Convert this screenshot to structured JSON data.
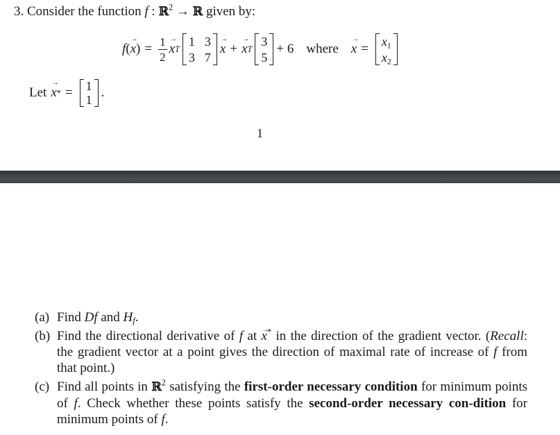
{
  "viewer": {
    "page_gap_color": "#3e4144"
  },
  "page1": {
    "heading": {
      "number": "3.",
      "text_before": "Consider the function",
      "func": "f",
      "colon": " : ",
      "domain": "ℝ",
      "domain_exp": "2",
      "arrow": " → ",
      "codomain": "ℝ",
      "text_after": " given by:"
    },
    "equation": {
      "lhs_func": "f",
      "lhs_arg": "x",
      "equals": "=",
      "frac_num": "1",
      "frac_den": "2",
      "transpose": "T",
      "matrix_A": [
        [
          "1",
          "3"
        ],
        [
          "3",
          "7"
        ]
      ],
      "plus": "+",
      "vector_b": [
        "3",
        "5"
      ],
      "constant": "+ 6",
      "where": "where",
      "x_vec": "x",
      "x_components": [
        "x",
        "x"
      ],
      "x_subscripts": [
        "1",
        "2"
      ]
    },
    "let_line": {
      "text": "Let",
      "var": "x",
      "star": "*",
      "equals": "=",
      "vector": [
        "1",
        "1"
      ],
      "period": "."
    },
    "page_number": "1"
  },
  "page2": {
    "parts": [
      {
        "label": "(a)",
        "segments": [
          "Find ",
          "Df",
          " and ",
          "H",
          "f",
          "."
        ]
      },
      {
        "label": "(b)",
        "text_1": "Find the directional derivative of ",
        "f": "f",
        "text_2": " at ",
        "x": "x",
        "star": "*",
        "text_3": " in the direction of the gradient vector. (",
        "recall": "Recall",
        "text_4": ": the gradient vector at a point gives the direction of maximal rate of increase of ",
        "f2": "f",
        "text_5": " from that point.)"
      },
      {
        "label": "(c)",
        "text_1": "Find all points in ",
        "R": "ℝ",
        "R_exp": "2",
        "text_2": " satisfying the ",
        "bold_1": "first-order necessary condition",
        "text_3": " for minimum points of ",
        "f": "f",
        "text_4": ". Check whether these points satisfy the ",
        "bold_2": "second-order necessary con-dition",
        "text_5": " for minimum points of ",
        "f2": "f",
        "text_6": "."
      }
    ]
  }
}
